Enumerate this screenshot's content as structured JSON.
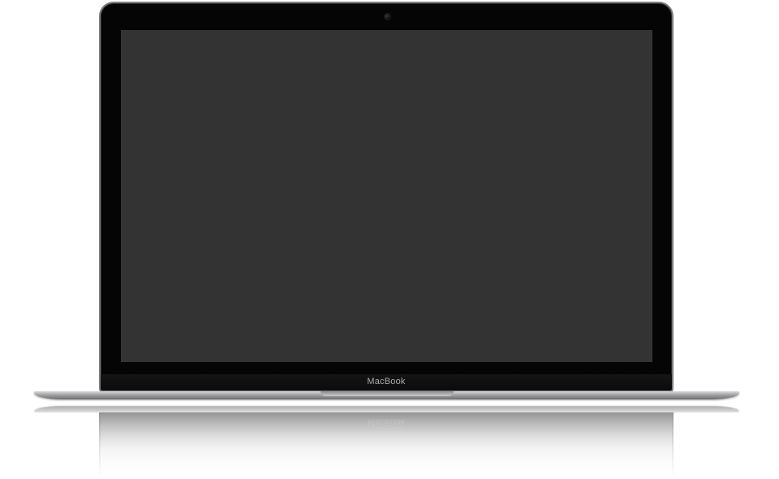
{
  "device": {
    "brand_label": "MacBook",
    "screen_color": "#333333",
    "bezel_color": "#050505",
    "base_color": "#a7a7aa"
  }
}
